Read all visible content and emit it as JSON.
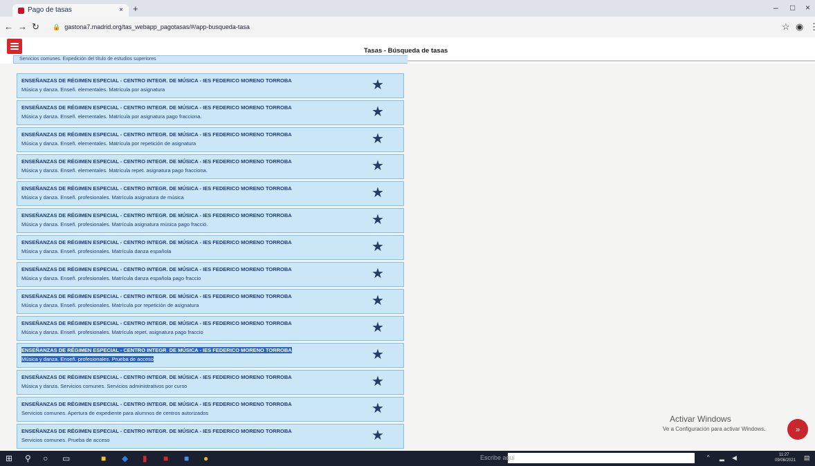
{
  "browser": {
    "tab_title": "Pago de tasas",
    "tab_close": "×",
    "new_tab": "+",
    "url": "gastona7.madrid.org/tas_webapp_pagotasas/#/app-busqueda-tasa",
    "win_min": "–",
    "win_max": "□",
    "win_close": "×"
  },
  "app": {
    "title": "Tasas - Búsqueda de tasas"
  },
  "list": {
    "top_fragment": "Servicios comunes. Expedición del título de estudios superiores",
    "items": [
      {
        "line1": "ENSEÑANZAS DE RÉGIMEN ESPECIAL - CENTRO INTEGR. DE MÚSICA - IES FEDERICO MORENO TORROBA",
        "line2": "Música y danza. Enseñ. elementales. Matrícula por asignatura"
      },
      {
        "line1": "ENSEÑANZAS DE RÉGIMEN ESPECIAL - CENTRO INTEGR. DE MÚSICA - IES FEDERICO MORENO TORROBA",
        "line2": "Música y danza. Enseñ. elementales. Matrícula por asignatura pago fracciona."
      },
      {
        "line1": "ENSEÑANZAS DE RÉGIMEN ESPECIAL - CENTRO INTEGR. DE MÚSICA - IES FEDERICO MORENO TORROBA",
        "line2": "Música y danza. Enseñ. elementales. Matrícula por repetición de asignatura"
      },
      {
        "line1": "ENSEÑANZAS DE RÉGIMEN ESPECIAL - CENTRO INTEGR. DE MÚSICA - IES FEDERICO MORENO TORROBA",
        "line2": "Música y danza. Enseñ. elementales. Matrícula repet. asignatura pago fracciona."
      },
      {
        "line1": "ENSEÑANZAS DE RÉGIMEN ESPECIAL - CENTRO INTEGR. DE MÚSICA - IES FEDERICO MORENO TORROBA",
        "line2": "Música y danza. Enseñ. profesionales. Matrícula asignatura de música"
      },
      {
        "line1": "ENSEÑANZAS DE RÉGIMEN ESPECIAL - CENTRO INTEGR. DE MÚSICA - IES FEDERICO MORENO TORROBA",
        "line2": "Música y danza. Enseñ. profesionales. Matrícula asignatura música pago fracció."
      },
      {
        "line1": "ENSEÑANZAS DE RÉGIMEN ESPECIAL - CENTRO INTEGR. DE MÚSICA - IES FEDERICO MORENO TORROBA",
        "line2": "Música y danza. Enseñ. profesionales. Matrícula danza española"
      },
      {
        "line1": "ENSEÑANZAS DE RÉGIMEN ESPECIAL - CENTRO INTEGR. DE MÚSICA - IES FEDERICO MORENO TORROBA",
        "line2": "Música y danza. Enseñ. profesionales. Matrícula danza española pago fraccio"
      },
      {
        "line1": "ENSEÑANZAS DE RÉGIMEN ESPECIAL - CENTRO INTEGR. DE MÚSICA - IES FEDERICO MORENO TORROBA",
        "line2": "Música y danza. Enseñ. profesionales. Matrícula por repetición de asignatura"
      },
      {
        "line1": "ENSEÑANZAS DE RÉGIMEN ESPECIAL - CENTRO INTEGR. DE MÚSICA - IES FEDERICO MORENO TORROBA",
        "line2": "Música y danza. Enseñ. profesionales. Matrícula repet. asignatura pago fraccio"
      },
      {
        "line1": "ENSEÑANZAS DE RÉGIMEN ESPECIAL - CENTRO INTEGR. DE MÚSICA - IES FEDERICO MORENO TORROBA",
        "line2": "Música y danza. Enseñ. profesionales. Prueba de acceso",
        "selected": true
      },
      {
        "line1": "ENSEÑANZAS DE RÉGIMEN ESPECIAL - CENTRO INTEGR. DE MÚSICA - IES FEDERICO MORENO TORROBA",
        "line2": "Música y danza. Servicios comunes. Servicios administrativos por curso"
      },
      {
        "line1": "ENSEÑANZAS DE RÉGIMEN ESPECIAL - CENTRO INTEGR. DE MÚSICA - IES FEDERICO MORENO TORROBA",
        "line2": "Servicios comunes. Apertura de expediente para alumnos de centros autorizados"
      },
      {
        "line1": "ENSEÑANZAS DE RÉGIMEN ESPECIAL - CENTRO INTEGR. DE MÚSICA - IES FEDERICO MORENO TORROBA",
        "line2": "Servicios comunes. Prueba de acceso"
      }
    ]
  },
  "watermark": {
    "title": "Activar Windows",
    "subtitle": "Ve a Configuración para activar Windows."
  },
  "fab": {
    "label": "»"
  },
  "taskbar": {
    "search_placeholder": "Escribe aquí",
    "time": "11:27",
    "date": "09/06/2021"
  },
  "colors": {
    "row_bg": "#cbe6f7",
    "row_border": "#7fc0ea",
    "accent_red": "#d9262b",
    "selection": "#2b63c5"
  }
}
